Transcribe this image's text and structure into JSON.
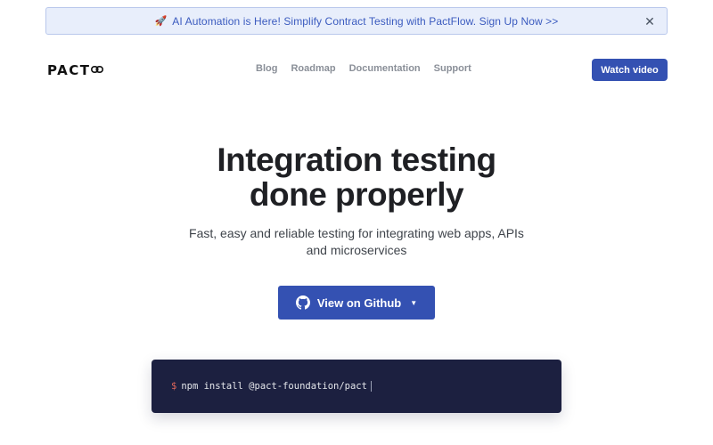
{
  "banner": {
    "icon": "rocket-icon",
    "text": "AI Automation is Here! Simplify Contract Testing with PactFlow. Sign Up Now >>",
    "close_icon": "close-icon"
  },
  "header": {
    "logo_text": "PACT",
    "logo_icon": "link-icon",
    "nav": [
      "Blog",
      "Roadmap",
      "Documentation",
      "Support"
    ],
    "cta_label": "Watch video"
  },
  "hero": {
    "title_line1": "Integration testing",
    "title_line2": "done properly",
    "subtitle": "Fast, easy and reliable testing for integrating web apps, APIs and microservices",
    "github_button_label": "View on Github",
    "github_icon": "github-icon",
    "caret_icon": "caret-down-icon"
  },
  "terminal": {
    "prompt": "$",
    "command": "npm install @pact-foundation/pact"
  },
  "colors": {
    "accent": "#3451b2",
    "banner_bg": "#e8eefb",
    "terminal_bg": "#1c2040"
  }
}
